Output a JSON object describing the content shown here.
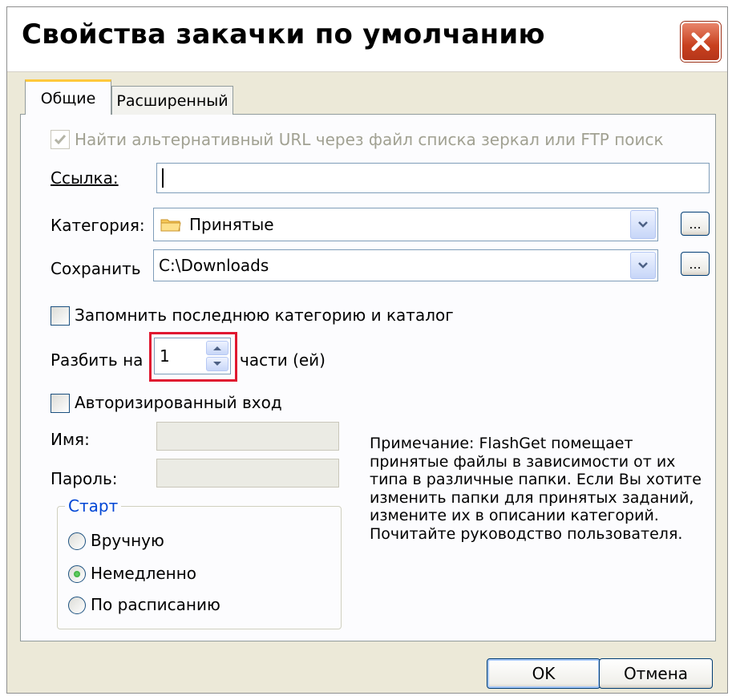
{
  "window": {
    "title": "Свойства закачки по умолчанию"
  },
  "tabs": [
    {
      "label": "Общие",
      "active": true
    },
    {
      "label": "Расширенный",
      "active": false
    }
  ],
  "general": {
    "alt_url_label": "Найти альтернативный URL через файл списка зеркал или FTP поиск",
    "alt_url_checked": true,
    "link_label": "Ссылка:",
    "link_value": "",
    "category_label": "Категория:",
    "category_value": "Принятые",
    "save_label": "Сохранить",
    "save_value": "C:\\Downloads",
    "browse_label": "...",
    "remember_label": "Запомнить последнюю категорию и каталог",
    "remember_checked": false,
    "split_label": "Разбить на",
    "split_value": "1",
    "split_suffix": "части (ей)",
    "auth_label": "Авторизированный вход",
    "auth_checked": false,
    "name_label": "Имя:",
    "password_label": "Пароль:"
  },
  "start": {
    "title": "Старт",
    "options": [
      {
        "label": "Вручную",
        "selected": false
      },
      {
        "label": "Немедленно",
        "selected": true
      },
      {
        "label": "По расписанию",
        "selected": false
      }
    ]
  },
  "note": "Примечание: FlashGet помещает принятые файлы в зависимости от их типа в различные папки. Если Вы хотите изменить папки для принятых заданий, измените их в описании категорий. Почитайте руководство пользователя.",
  "buttons": {
    "ok": "OK",
    "cancel": "Отмена"
  },
  "colors": {
    "highlight": "#e01830",
    "group_title": "#0046d5",
    "close_button": "#c8401e"
  }
}
